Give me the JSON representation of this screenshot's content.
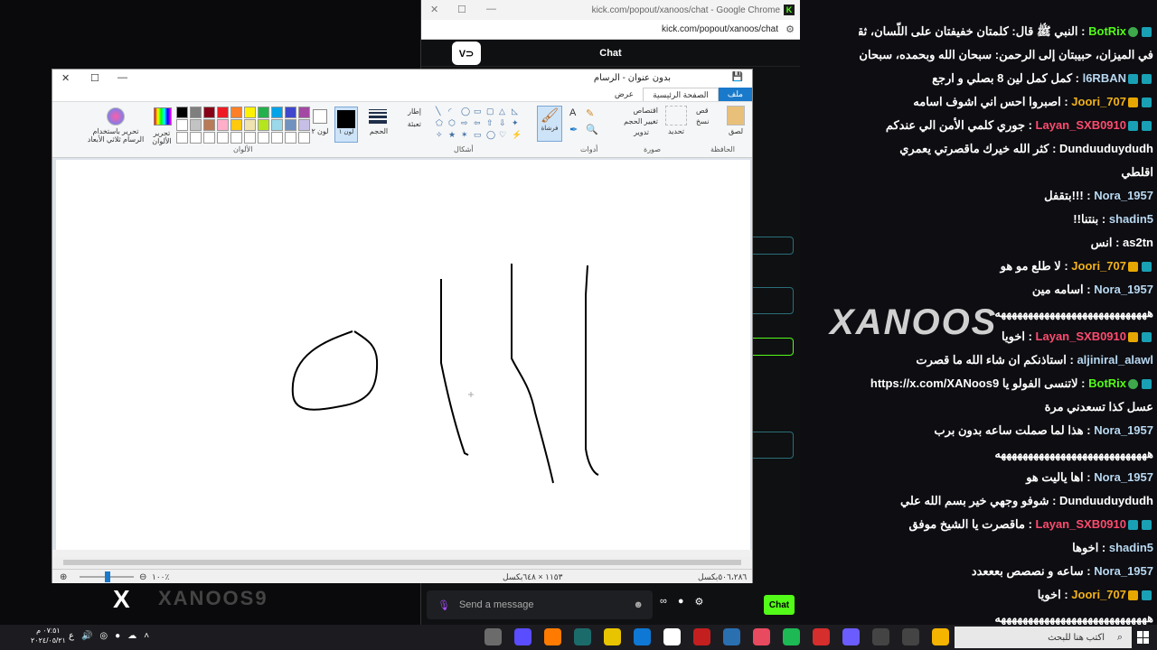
{
  "chrome": {
    "title": "kick.com/popout/xanoos/chat - Google Chrome",
    "url": "kick.com/popout/xanoos/chat",
    "chat_header": "Chat",
    "send_placeholder": "Send a message",
    "chat_button": "Chat"
  },
  "overlay": {
    "messages": [
      {
        "user": "BotRix",
        "sep": ":",
        "text": "النبي ﷺ قال: كلمتان خفيفتان على اللّسان، ثقيلتان",
        "cls": "u-green",
        "badges": [
          "blue",
          "green"
        ]
      },
      {
        "user": "",
        "sep": "",
        "text": "في الميزان، حبيبتان إلى الرحمن: سبحان الله وبحمده، سبحان الله العظيم",
        "cls": "u-white",
        "badges": []
      },
      {
        "user": "l6RBAN",
        "sep": ":",
        "text": "كمل كمل لين 8 بصلي و ارجع",
        "cls": "u-blue",
        "badges": [
          "blue",
          "blue"
        ]
      },
      {
        "user": "Joori_707",
        "sep": ":",
        "text": "اصبروا احس اني اشوف اسامه",
        "cls": "u-gold",
        "badges": [
          "blue",
          "gold"
        ]
      },
      {
        "user": "Layan_SXB0910",
        "sep": ":",
        "text": "جوري كلمي الأمن الي عندكم",
        "cls": "u-red",
        "badges": [
          "blue",
          "blue"
        ]
      },
      {
        "user": "Dunduuduydudh",
        "sep": ":",
        "text": "كثر الله خيرك ماقصرتي يعمري",
        "cls": "u-white",
        "badges": []
      },
      {
        "user": "",
        "sep": "",
        "text": "اقلطي",
        "cls": "u-white",
        "badges": []
      },
      {
        "user": "Nora_1957",
        "sep": ":",
        "text": "!!!بتقفل",
        "cls": "u-blue",
        "badges": []
      },
      {
        "user": "shadin5",
        "sep": ":",
        "text": "بنتنا!!",
        "cls": "u-blue",
        "badges": []
      },
      {
        "user": "as2tn",
        "sep": ":",
        "text": "انس",
        "cls": "u-white",
        "badges": []
      },
      {
        "user": "Joori_707",
        "sep": ":",
        "text": "لا طلع مو هو",
        "cls": "u-gold",
        "badges": [
          "blue",
          "gold"
        ]
      },
      {
        "user": "Nora_1957",
        "sep": ":",
        "text": "اسامه مين",
        "cls": "u-blue",
        "badges": []
      },
      {
        "user": "",
        "sep": "",
        "text": "ههههههههههههههههههههههههههههه",
        "cls": "u-white",
        "badges": []
      },
      {
        "user": "Layan_SXB0910",
        "sep": ":",
        "text": "اخويا",
        "cls": "u-red",
        "badges": [
          "blue",
          "gold"
        ]
      },
      {
        "user": "aljiniral_alawl",
        "sep": ":",
        "text": "استاذنكم ان شاء الله ما قصرت",
        "cls": "u-blue",
        "badges": []
      },
      {
        "user": "BotRix",
        "sep": ":",
        "text": "لاتنسى الفولو يا https://x.com/XANoos9",
        "cls": "u-green",
        "badges": [
          "blue",
          "green"
        ]
      },
      {
        "user": "",
        "sep": "",
        "text": "عسل كذا تسعدني مرة",
        "cls": "u-white",
        "badges": []
      },
      {
        "user": "Nora_1957",
        "sep": ":",
        "text": "هذا لما صملت ساعه بدون برب",
        "cls": "u-blue",
        "badges": []
      },
      {
        "user": "",
        "sep": "",
        "text": "ههههههههههههههههههههههههههههه",
        "cls": "u-white",
        "badges": []
      },
      {
        "user": "Nora_1957",
        "sep": ":",
        "text": "اها ياليت هو",
        "cls": "u-blue",
        "badges": []
      },
      {
        "user": "Dunduuduydudh",
        "sep": ":",
        "text": "شوفو وجهي خير بسم الله علي",
        "cls": "u-white",
        "badges": []
      },
      {
        "user": "Layan_SXB0910",
        "sep": ":",
        "text": "ماقصرت يا الشيخ موفق",
        "cls": "u-red",
        "badges": [
          "blue",
          "blue"
        ]
      },
      {
        "user": "shadin5",
        "sep": ":",
        "text": "اخوها",
        "cls": "u-blue",
        "badges": []
      },
      {
        "user": "Nora_1957",
        "sep": ":",
        "text": "ساعه و نصصص بعععدد",
        "cls": "u-blue",
        "badges": []
      },
      {
        "user": "Joori_707",
        "sep": ":",
        "text": "اخويا",
        "cls": "u-gold",
        "badges": [
          "blue",
          "gold"
        ]
      },
      {
        "user": "",
        "sep": "",
        "text": "ههههههههههههههههههههههههههههه",
        "cls": "u-white",
        "badges": []
      }
    ],
    "watermark": "XANOOS"
  },
  "stream": {
    "x_logo": "X",
    "name": "XANOOS9"
  },
  "paint": {
    "title": "بدون عنوان - الرسام",
    "tabs": [
      "ملف",
      "الصفحة الرئيسية",
      "عرض"
    ],
    "groups": {
      "clipboard": "الحافظة",
      "image": "صورة",
      "tools": "أدوات",
      "shapes": "أشكال",
      "colors": "الألوان"
    },
    "buttons": {
      "paste": "لصق",
      "cut": "قص",
      "copy": "نسخ",
      "select": "تحديد",
      "crop": "اقتصاص",
      "resize": "تغيير الحجم",
      "rotate": "تدوير",
      "brushes": "فرشاة",
      "outline": "إطار",
      "fill": "تعبئة",
      "size": "الحجم",
      "color1": "لون ١",
      "color2": "لون ٢",
      "edit_colors": "تحرير الألوان",
      "paint3d": "تحرير باستخدام الرسام ثلاثي الأبعاد"
    },
    "palette": [
      "#000000",
      "#7f7f7f",
      "#880015",
      "#ed1c24",
      "#ff7f27",
      "#fff200",
      "#22b14c",
      "#00a2e8",
      "#3f48cc",
      "#a349a4",
      "#ffffff",
      "#c3c3c3",
      "#b97a57",
      "#ffaec9",
      "#ffc90e",
      "#efe4b0",
      "#b5e61d",
      "#99d9ea",
      "#7092be",
      "#c8bfe7",
      "#ffffff",
      "#ffffff",
      "#ffffff",
      "#ffffff",
      "#ffffff",
      "#ffffff",
      "#ffffff",
      "#ffffff",
      "#ffffff",
      "#ffffff"
    ],
    "status": {
      "cursor": "٥٠٦،٢٨٦بكسل",
      "canvas_size": "١١٥٣ × ٦٤٨بكسل",
      "zoom": "١٠٠٪"
    }
  },
  "taskbar": {
    "search_placeholder": "اكتب هنا للبحث",
    "time": "٠٧:٥١ م",
    "date": "٢٠٢٤/٠٥/٢١",
    "icon_colors": [
      "#6b6b6b",
      "#5a4cff",
      "#ff7b00",
      "#1c6b6b",
      "#e8c400",
      "#0e78d4",
      "#ffffff",
      "#c41f1f",
      "#2a6fb0",
      "#e84a5f",
      "#1db954",
      "#d62d2d",
      "#6a5cff",
      "#444444",
      "#444444",
      "#f4b400"
    ]
  }
}
